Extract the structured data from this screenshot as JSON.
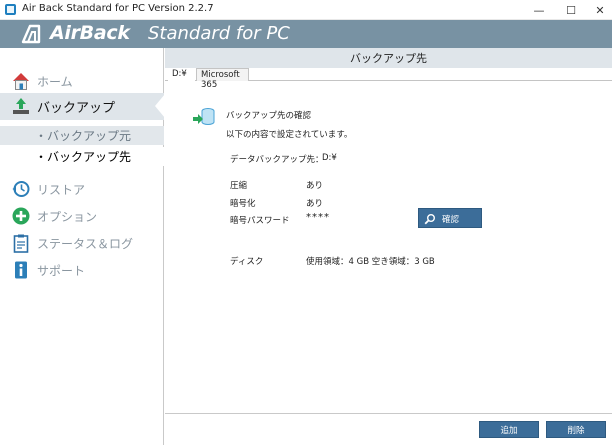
{
  "window": {
    "title": "Air Back Standard for PC Version 2.2.7",
    "controls": {
      "minimize": "—",
      "maximize": "☐",
      "close": "✕"
    }
  },
  "brand": {
    "name": "AirBack",
    "subtitle": "Standard for PC",
    "color": "#7892a3"
  },
  "sidebar": {
    "items": [
      {
        "label": "ホーム",
        "icon": "home-icon"
      },
      {
        "label": "バックアップ",
        "icon": "upload-tray-icon",
        "selected": true
      },
      {
        "label": "リストア",
        "icon": "clock-arrow-icon"
      },
      {
        "label": "オプション",
        "icon": "plus-circle-icon"
      },
      {
        "label": "ステータス＆ログ",
        "icon": "clipboard-icon"
      },
      {
        "label": "サポート",
        "icon": "info-icon"
      }
    ],
    "backup_sub": [
      {
        "label": "・バックアップ元"
      },
      {
        "label": "・バックアップ先",
        "selected": true
      }
    ]
  },
  "main": {
    "panel_title": "バックアップ先",
    "tabs": [
      {
        "label": "D:¥",
        "active": true
      },
      {
        "label": "Microsoft 365",
        "active": false
      }
    ],
    "confirm_title": "バックアップ先の確認",
    "confirm_desc": "以下の内容で設定されています。",
    "fields": {
      "destination": {
        "label": "データバックアップ先：",
        "value": "D:¥"
      },
      "compression": {
        "label": "圧縮",
        "value": "あり"
      },
      "encryption": {
        "label": "暗号化",
        "value": "あり"
      },
      "password": {
        "label": "暗号パスワード",
        "value": "****"
      },
      "disk": {
        "label": "ディスク",
        "value": "使用領域：4 GB 空き領域：3 GB"
      }
    },
    "verify_button": "確認",
    "footer": {
      "add": "追加",
      "delete": "削除"
    }
  },
  "colors": {
    "accent": "#3c6d99",
    "nav_selected_bg": "#dfe5ea",
    "nav_inactive_text": "#8a96a0"
  }
}
